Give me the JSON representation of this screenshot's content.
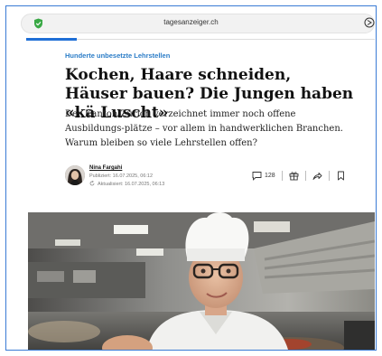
{
  "browser": {
    "url": "tagesanzeiger.ch"
  },
  "article": {
    "kicker": "Hunderte unbesetzte Lehrstellen",
    "headline": "Kochen, Haare schneiden, Häuser bauen? Die Jungen haben «kä Luscht»",
    "lead": "Der Kanton Zürich verzeichnet immer noch offene Ausbildungs-plätze – vor allem in handwerklichen Branchen. Warum bleiben so viele Lehrstellen offen?"
  },
  "byline": {
    "author": "Nina Fargahi",
    "published": "Publiziert: 16.07.2025, 06:12",
    "updated": "Aktualisiert: 16.07.2025, 06:13"
  },
  "actions": {
    "comments_count": "128",
    "icons": [
      "comment-icon",
      "gift-icon",
      "share-icon",
      "bookmark-icon"
    ]
  },
  "colors": {
    "accent": "#2a7cc7",
    "frame": "#3a7bd5"
  }
}
